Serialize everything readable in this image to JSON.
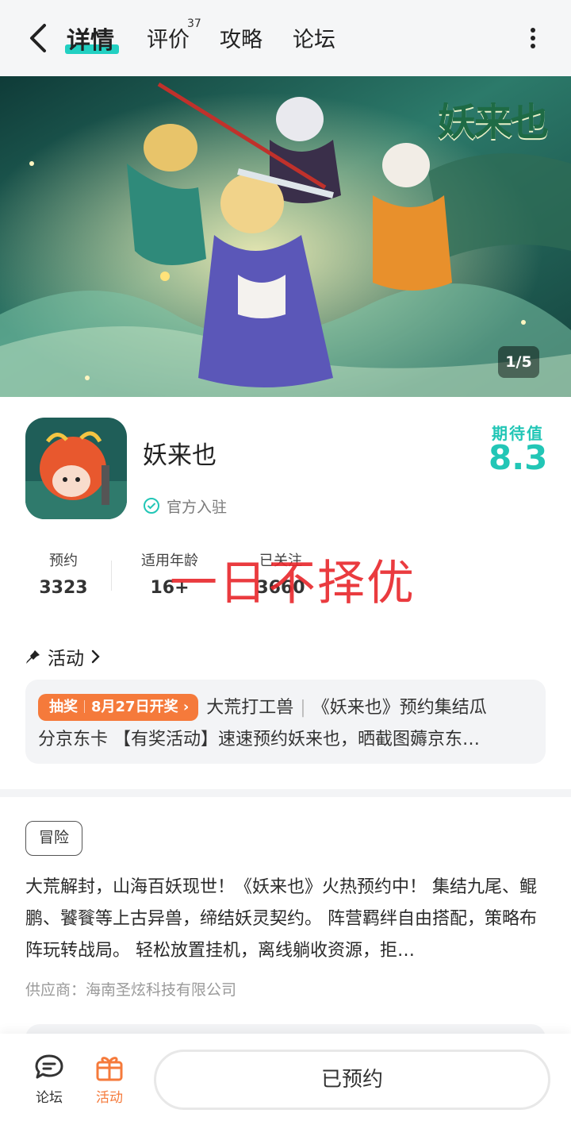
{
  "header": {
    "tabs": [
      {
        "label": "详情",
        "active": true
      },
      {
        "label": "评价",
        "badge": "37"
      },
      {
        "label": "攻略"
      },
      {
        "label": "论坛"
      }
    ],
    "accent_color": "#22d0c2"
  },
  "banner": {
    "logo_text": "妖来也",
    "page_indicator": "1/5"
  },
  "app": {
    "name": "妖来也",
    "official_label": "官方入驻",
    "expectation_label": "期待值",
    "expectation_value": "8.3",
    "stats": [
      {
        "label": "预约",
        "value": "3323"
      },
      {
        "label": "适用年龄",
        "value": "16+"
      },
      {
        "label": "已关注",
        "value": "3660"
      }
    ],
    "watermark": "一日不择优"
  },
  "activity": {
    "title": "活动",
    "pill_type": "抽奖",
    "pill_date": "8月27日开奖",
    "pill_arrow": "›",
    "author": "大荒打工兽",
    "separator": "|",
    "headline": "《妖来也》预约集结瓜",
    "line2": "分京东卡 【有奖活动】速速预约妖来也，晒截图薅京东…"
  },
  "description": {
    "genre": "冒险",
    "text": "大荒解封，山海百妖现世！《妖来也》火热预约中！ 集结九尾、鲲鹏、饕餮等上古异兽，缔结妖灵契约。 阵营羁绊自由搭配，策略布阵玩转战局。 轻松放置挂机，离线躺收资源，拒…",
    "supplier": "供应商：海南圣炫科技有限公司"
  },
  "bottom_bar": {
    "forum_label": "论坛",
    "activity_label": "活动",
    "reserve_label": "已预约",
    "activity_color": "#f57a3b"
  }
}
